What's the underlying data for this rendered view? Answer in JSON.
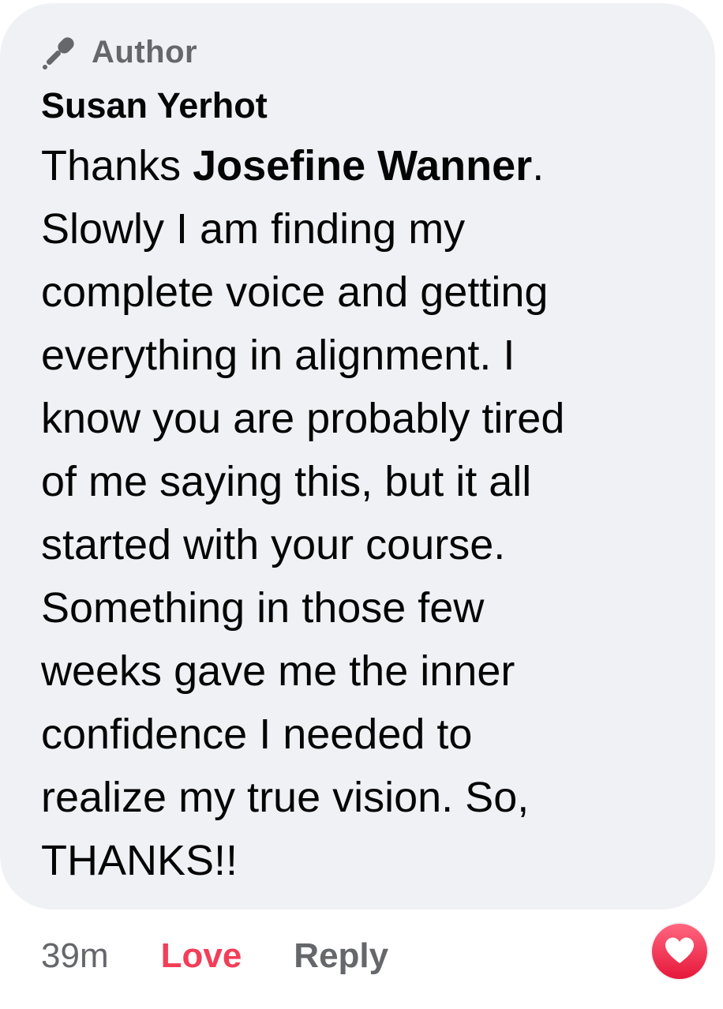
{
  "comment": {
    "badge_label": "Author",
    "badge_icon": "microphone-icon",
    "author_name": "Susan Yerhot",
    "text_lines": [
      {
        "before": "Thanks ",
        "mention": "Josefine Wanner",
        "after": "."
      },
      {
        "text": "Slowly I am finding my"
      },
      {
        "text": "complete voice and getting"
      },
      {
        "text": "everything in alignment. I"
      },
      {
        "text": "know you are probably tired"
      },
      {
        "text": "of me saying this, but it all"
      },
      {
        "text": "started with your course."
      },
      {
        "text": "Something in those few"
      },
      {
        "text": "weeks gave me the inner"
      },
      {
        "text": "confidence I needed to"
      },
      {
        "text": "realize my true vision. So,"
      },
      {
        "text": "THANKS!!"
      }
    ],
    "bubble_color": "#f0f1f5"
  },
  "actions": {
    "time": "39m",
    "love_label": "Love",
    "reply_label": "Reply",
    "love_color": "#f33e58",
    "muted_color": "#65676b"
  },
  "reaction": {
    "icon": "heart-icon",
    "color": "#f33e58"
  }
}
